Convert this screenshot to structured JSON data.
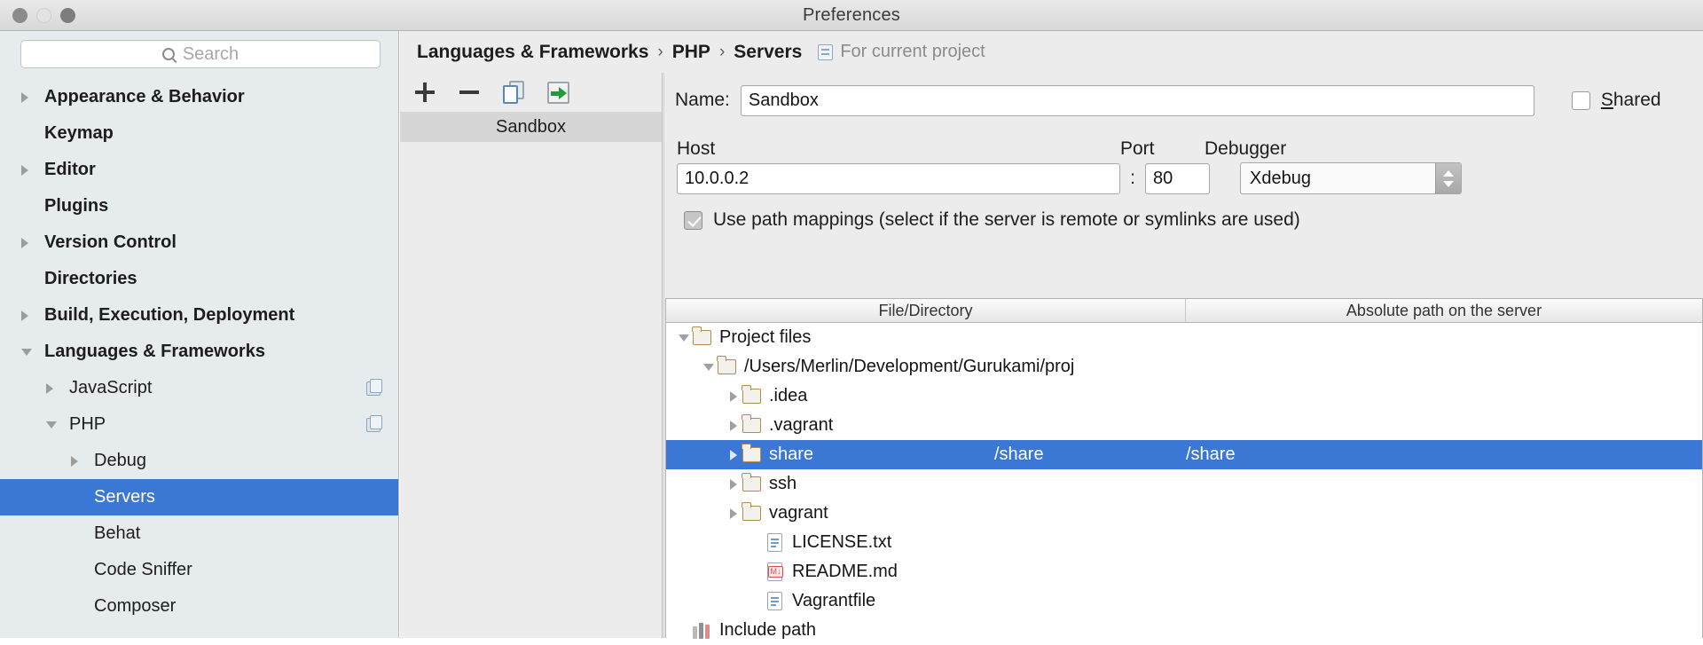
{
  "window": {
    "title": "Preferences",
    "controls": [
      "close-button",
      "minimize-button",
      "zoom-button"
    ]
  },
  "search": {
    "placeholder": "Search",
    "value": "",
    "icon": "search-icon"
  },
  "sidebar": {
    "items": [
      {
        "label": "Appearance & Behavior",
        "level": 0,
        "arrow": "right",
        "selected": false,
        "badge": false
      },
      {
        "label": "Keymap",
        "level": 0,
        "arrow": "none",
        "selected": false,
        "badge": false
      },
      {
        "label": "Editor",
        "level": 0,
        "arrow": "right",
        "selected": false,
        "badge": false
      },
      {
        "label": "Plugins",
        "level": 0,
        "arrow": "none",
        "selected": false,
        "badge": false
      },
      {
        "label": "Version Control",
        "level": 0,
        "arrow": "right",
        "selected": false,
        "badge": false
      },
      {
        "label": "Directories",
        "level": 0,
        "arrow": "none",
        "selected": false,
        "badge": false
      },
      {
        "label": "Build, Execution, Deployment",
        "level": 0,
        "arrow": "right",
        "selected": false,
        "badge": false
      },
      {
        "label": "Languages & Frameworks",
        "level": 0,
        "arrow": "down",
        "selected": false,
        "badge": false
      },
      {
        "label": "JavaScript",
        "level": 1,
        "arrow": "right",
        "selected": false,
        "badge": true
      },
      {
        "label": "PHP",
        "level": 1,
        "arrow": "down",
        "selected": false,
        "badge": true
      },
      {
        "label": "Debug",
        "level": 2,
        "arrow": "right",
        "selected": false,
        "badge": false
      },
      {
        "label": "Servers",
        "level": 2,
        "arrow": "none",
        "selected": true,
        "badge": false
      },
      {
        "label": "Behat",
        "level": 2,
        "arrow": "none",
        "selected": false,
        "badge": false
      },
      {
        "label": "Code Sniffer",
        "level": 2,
        "arrow": "none",
        "selected": false,
        "badge": false
      },
      {
        "label": "Composer",
        "level": 2,
        "arrow": "none",
        "selected": false,
        "badge": false
      }
    ]
  },
  "breadcrumb": {
    "crumbs": [
      "Languages & Frameworks",
      "PHP",
      "Servers"
    ],
    "separator": "›",
    "scope_label": "For current project",
    "scope_icon": "project-scope-icon"
  },
  "server_list": {
    "toolbar": [
      {
        "name": "add-server-button",
        "icon": "plus-icon"
      },
      {
        "name": "remove-server-button",
        "icon": "minus-icon"
      },
      {
        "name": "copy-server-button",
        "icon": "copy-icon"
      },
      {
        "name": "import-server-button",
        "icon": "import-arrow-icon"
      }
    ],
    "servers": [
      {
        "label": "Sandbox",
        "selected": true
      }
    ]
  },
  "detail": {
    "name_label": "Name:",
    "name_value": "Sandbox",
    "shared_label_prefix": "",
    "shared_label_mnemonic": "S",
    "shared_label_rest": "hared",
    "shared_checked": false,
    "host_label": "Host",
    "host_value": "10.0.0.2",
    "colon": ":",
    "port_label": "Port",
    "port_value": "80",
    "debugger_label": "Debugger",
    "debugger_value": "Xdebug",
    "path_mappings_label": "Use path mappings (select if the server is remote or symlinks are used)",
    "path_mappings_checked": true
  },
  "mapping_table": {
    "columns": [
      "File/Directory",
      "Absolute path on the server"
    ],
    "rows": [
      {
        "label": "Project files",
        "server_path": "",
        "indent": 0,
        "arrow": "down",
        "icon": "folder-icon",
        "selected": false
      },
      {
        "label": "/Users/Merlin/Development/Gurukami/proj",
        "server_path": "",
        "indent": 1,
        "arrow": "down",
        "icon": "folder-icon",
        "selected": false,
        "truncated": true
      },
      {
        "label": ".idea",
        "server_path": "",
        "indent": 2,
        "arrow": "right",
        "icon": "folder-icon",
        "selected": false
      },
      {
        "label": ".vagrant",
        "server_path": "",
        "indent": 2,
        "arrow": "right",
        "icon": "folder-icon",
        "selected": false
      },
      {
        "label": "share",
        "server_path": "/share",
        "indent": 2,
        "arrow": "right",
        "icon": "folder-icon",
        "selected": true
      },
      {
        "label": "ssh",
        "server_path": "",
        "indent": 2,
        "arrow": "right",
        "icon": "folder-icon",
        "selected": false
      },
      {
        "label": "vagrant",
        "server_path": "",
        "indent": 2,
        "arrow": "right",
        "icon": "folder-icon",
        "selected": false
      },
      {
        "label": "LICENSE.txt",
        "server_path": "",
        "indent": 3,
        "arrow": "none",
        "icon": "text-file-icon",
        "selected": false
      },
      {
        "label": "README.md",
        "server_path": "",
        "indent": 3,
        "arrow": "none",
        "icon": "markdown-file-icon",
        "selected": false
      },
      {
        "label": "Vagrantfile",
        "server_path": "",
        "indent": 3,
        "arrow": "none",
        "icon": "text-file-icon",
        "selected": false
      },
      {
        "label": "Include path",
        "server_path": "",
        "indent": 0,
        "arrow": "none",
        "icon": "include-path-icon",
        "selected": false
      }
    ]
  },
  "colors": {
    "selection_blue": "#3b77d4",
    "sidebar_bg": "#e6ebee",
    "panel_bg": "#ececec",
    "folder_gold": "#b08d4f"
  }
}
